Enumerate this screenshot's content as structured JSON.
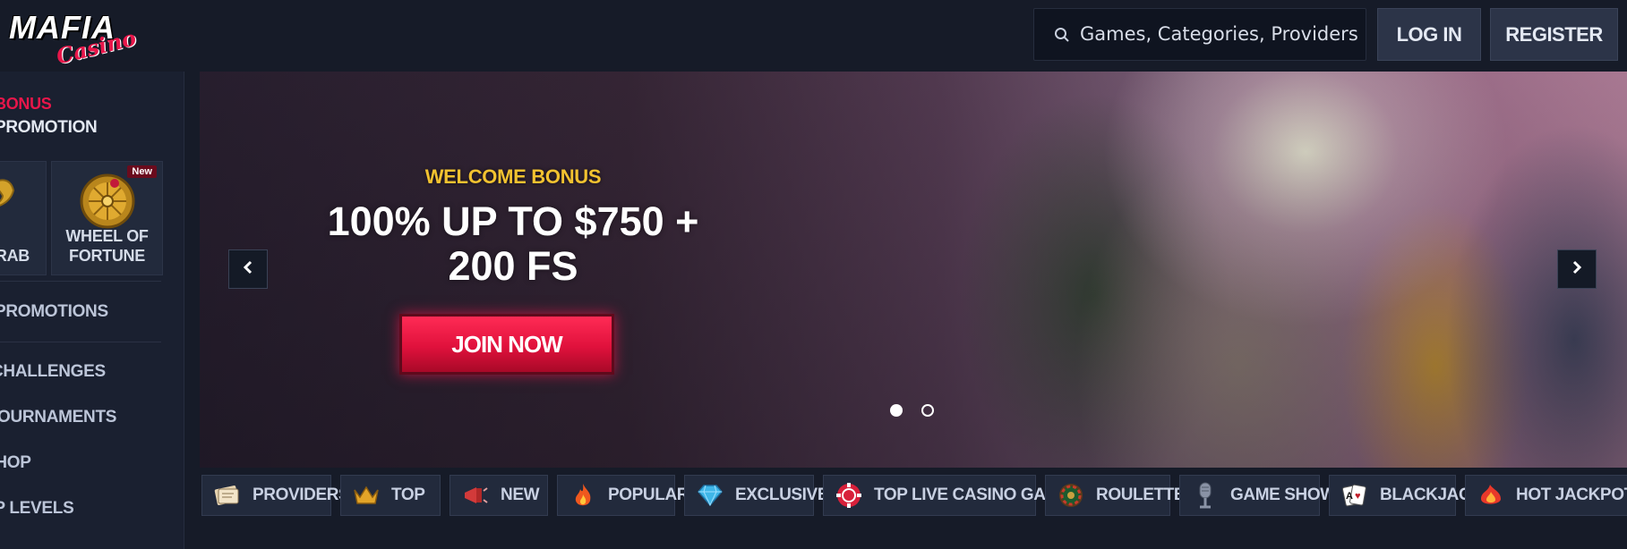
{
  "header": {
    "logo_top": "MAFIA",
    "logo_sub": "Casino",
    "search_placeholder": "Games, Categories, Providers",
    "login_label": "LOG IN",
    "register_label": "REGISTER"
  },
  "sidebar": {
    "bonus_label": "BONUS",
    "promotion_label": "PROMOTION",
    "tiles": [
      {
        "label": "CRAB"
      },
      {
        "label": "WHEEL OF FORTUNE",
        "badge": "New"
      }
    ],
    "items": [
      {
        "label": "PROMOTIONS"
      },
      {
        "label": "CHALLENGES"
      },
      {
        "label": "TOURNAMENTS"
      },
      {
        "label": "SHOP"
      },
      {
        "label": "VIP LEVELS"
      }
    ]
  },
  "banner": {
    "kicker": "WELCOME BONUS",
    "headline_line1": "100% UP TO $750 +",
    "headline_line2": "200 FS",
    "cta_label": "JOIN NOW",
    "slides_total": 2,
    "active_slide": 1
  },
  "categories": [
    {
      "label": "PROVIDERS",
      "icon": "providers-icon"
    },
    {
      "label": "TOP",
      "icon": "crown-icon"
    },
    {
      "label": "NEW",
      "icon": "megaphone-icon"
    },
    {
      "label": "POPULAR",
      "icon": "fire-icon"
    },
    {
      "label": "EXCLUSIVE",
      "icon": "diamond-icon"
    },
    {
      "label": "TOP LIVE CASINO GAMES",
      "icon": "poker-chip-icon"
    },
    {
      "label": "ROULETTE",
      "icon": "roulette-icon"
    },
    {
      "label": "GAME SHOWS",
      "icon": "microphone-icon"
    },
    {
      "label": "BLACKJACK",
      "icon": "cards-icon"
    },
    {
      "label": "HOT JACKPOTS",
      "icon": "hot-icon"
    }
  ],
  "colors": {
    "accent_red": "#e8164a",
    "gold": "#f2c230",
    "bg": "#161b28"
  }
}
